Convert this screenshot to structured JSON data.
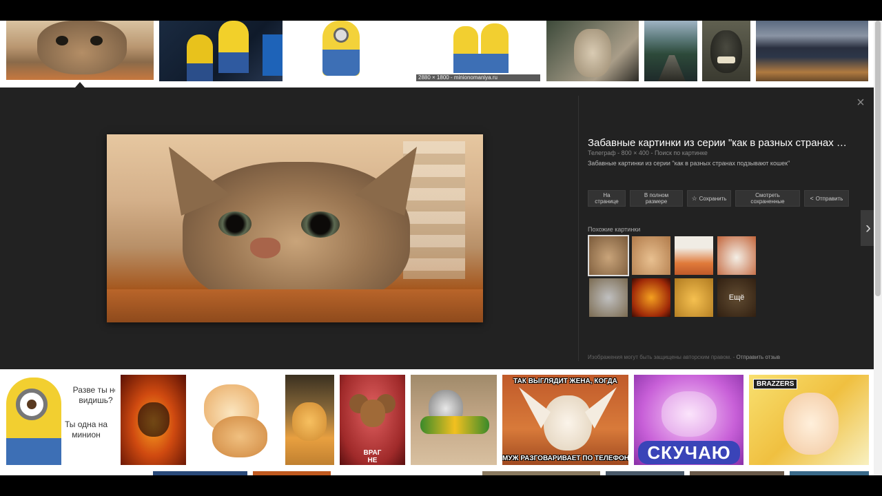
{
  "top_row": {
    "size_caption": "2880 × 1800 - minionomaniya.ru"
  },
  "preview": {
    "title": "Забавные картинки из серии \"как в разных странах …",
    "meta": "Телеграф - 800 × 400 - Поиск по картинке",
    "description": "Забавные картинки из серии \"как в разных странах подзывают кошек\"",
    "buttons": {
      "visit_line1": "На",
      "visit_line2": "странице",
      "fullsize_line1": "В полном",
      "fullsize_line2": "размере",
      "save": "Сохранить",
      "view_saved_line1": "Смотреть",
      "view_saved_line2": "сохраненные",
      "share": "Отправить"
    },
    "similar_title": "Похожие картинки",
    "more_label": "Ещё",
    "copyright_note": "Изображения могут быть защищены авторским правом.",
    "feedback_link": "Отправить отзыв",
    "close_symbol": "×",
    "next_symbol": "›"
  },
  "bottom_row": {
    "minion_line1": "Разве ты не",
    "minion_line2": "видишь?",
    "minion_line3": "Ты одна на",
    "minion_line4": "минион",
    "fox_top": "ТАК ВЫГЛЯДИТ ЖЕНА, КОГДА",
    "fox_bottom": "МУЖ РАЗГОВАРИВАЕТ ПО ТЕЛЕФОНУ",
    "skuchayu": "СКУЧАЮ",
    "brazzers": "BRAZZERS",
    "cheb_line1": "ВРАГ",
    "cheb_line2": "НЕ"
  },
  "icons": {
    "save": "star-icon",
    "share": "share-icon"
  }
}
